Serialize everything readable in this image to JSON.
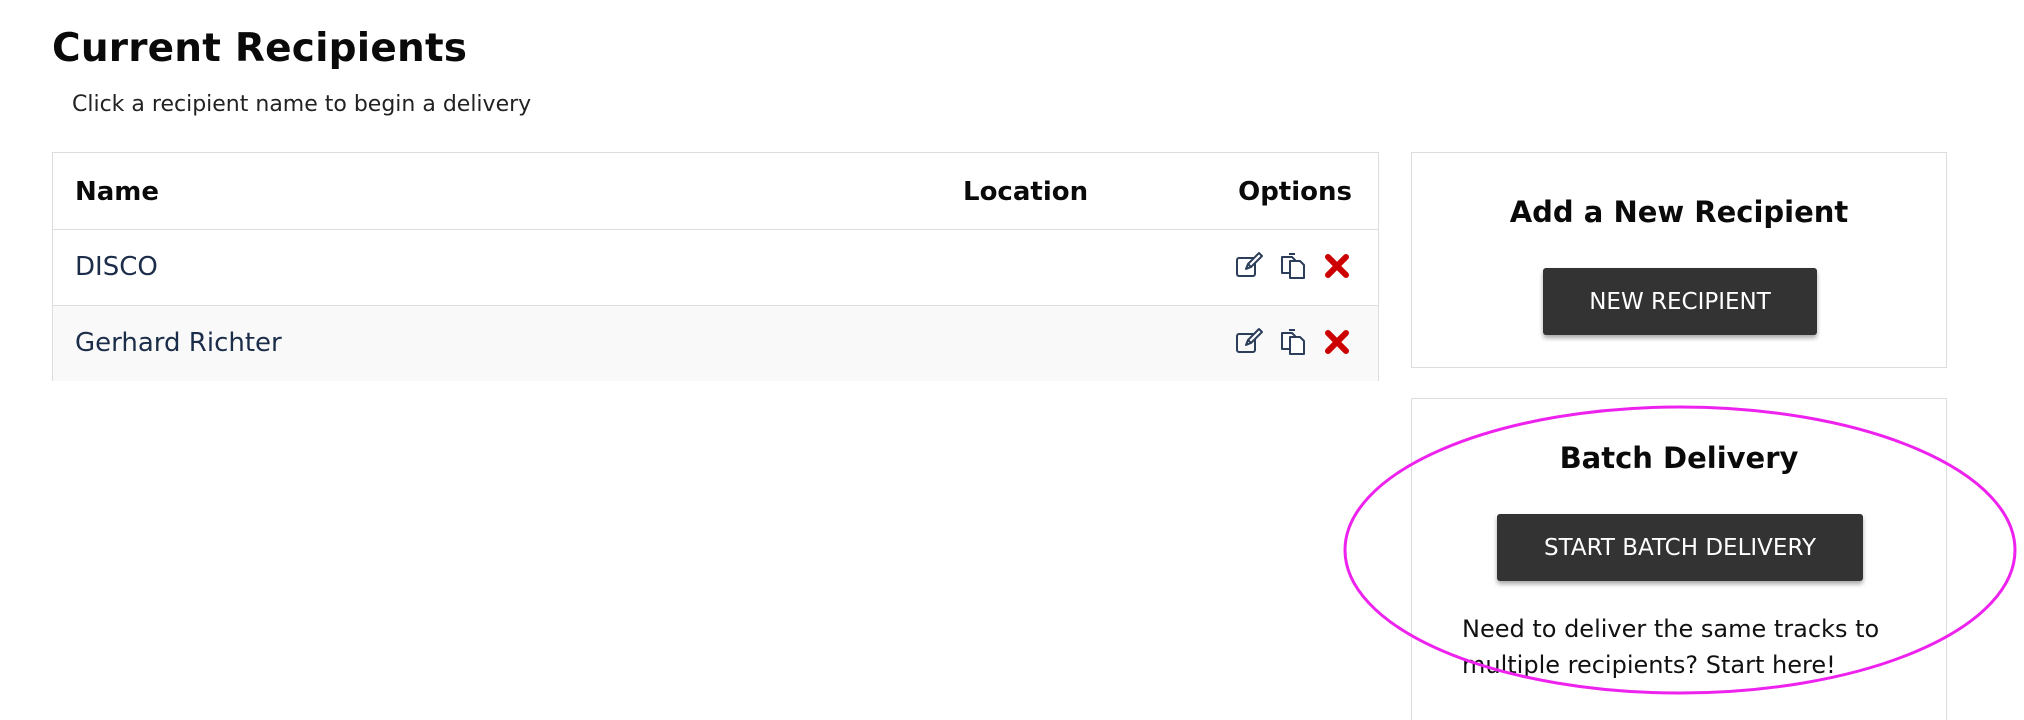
{
  "page": {
    "title": "Current Recipients",
    "subtitle": "Click a recipient name to begin a delivery"
  },
  "table": {
    "headers": {
      "name": "Name",
      "location": "Location",
      "options": "Options"
    },
    "rows": [
      {
        "name": "DISCO",
        "location": ""
      },
      {
        "name": "Gerhard Richter",
        "location": ""
      }
    ],
    "row_icons": [
      "edit-icon",
      "copy-icon",
      "delete-icon"
    ]
  },
  "add_card": {
    "title": "Add a New Recipient",
    "button_label": "NEW RECIPIENT"
  },
  "batch_card": {
    "title": "Batch Delivery",
    "button_label": "START BATCH DELIVERY",
    "description": "Need to deliver the same tracks to multiple recipients? Start here!"
  },
  "colors": {
    "button_bg": "#333333",
    "link_text": "#1c2d4a",
    "icon_edit": "#2c3e5a",
    "icon_delete": "#cc0000",
    "highlight": "#ee22ee"
  }
}
